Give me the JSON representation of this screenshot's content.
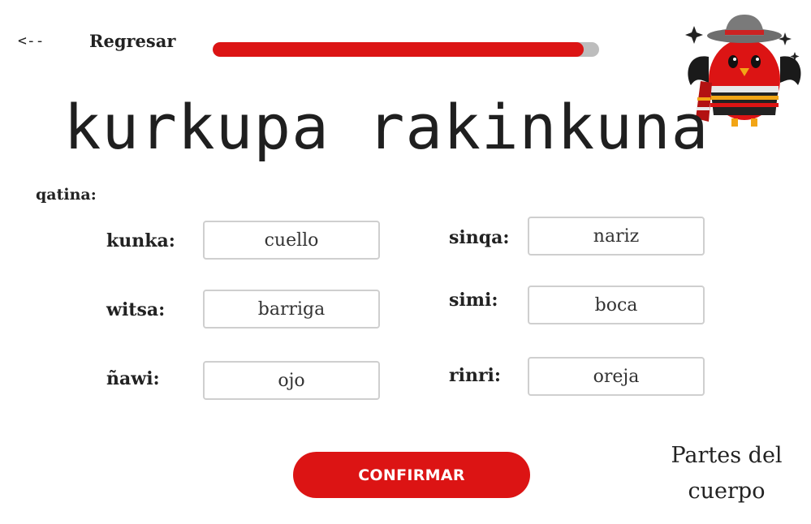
{
  "nav": {
    "back_arrow": "<--",
    "back_label": "Regresar"
  },
  "progress": {
    "fraction": 0.96,
    "fill_color": "#dc1414",
    "track_color": "#bdbdbd"
  },
  "mascot": {
    "icon": "red-bird-mascot-icon",
    "description_color": "#dc1414"
  },
  "title": "kurkupa rakinkuna",
  "instruction": "qatina:",
  "pairs": [
    {
      "label": "kunka:",
      "answer": "cuello"
    },
    {
      "label": "witsa:",
      "answer": "barriga"
    },
    {
      "label": "ñawi:",
      "answer": "ojo"
    },
    {
      "label": "sinqa:",
      "answer": "nariz"
    },
    {
      "label": "simi:",
      "answer": "boca"
    },
    {
      "label": "rinri:",
      "answer": "oreja"
    }
  ],
  "confirm_label": "CONFIRMAR",
  "topic": {
    "line1": "Partes del",
    "line2": "cuerpo"
  },
  "accent_color": "#dc1414"
}
